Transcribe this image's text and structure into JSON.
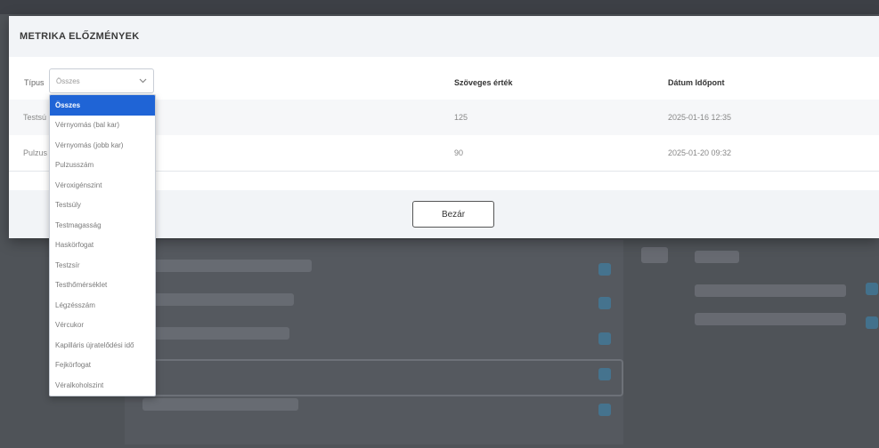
{
  "modal": {
    "title": "METRIKA ELŐZMÉNYEK",
    "filter": {
      "label": "Típus",
      "selected": "Összes"
    },
    "columns": {
      "text_value": "Szöveges érték",
      "datetime": "Dátum Időpont"
    },
    "rows": [
      {
        "type": "Testsú",
        "value": "125",
        "datetime": "2025-01-16 12:35"
      },
      {
        "type": "Pulzus",
        "value": "90",
        "datetime": "2025-01-20 09:32"
      }
    ],
    "close_label": "Bezár"
  },
  "dropdown": {
    "options": [
      "Összes",
      "Vérnyomás (bal kar)",
      "Vérnyomás (jobb kar)",
      "Pulzusszám",
      "Véroxigénszint",
      "Testsúly",
      "Testmagasság",
      "Haskörfogat",
      "Testzsír",
      "Testhőmérséklet",
      "Légzésszám",
      "Vércukor",
      "Kapilláris újratelődési idő",
      "Fejkörfogat",
      "Véralkoholszint"
    ],
    "selected_index": 0
  },
  "colors": {
    "accent": "#1f64d6"
  }
}
